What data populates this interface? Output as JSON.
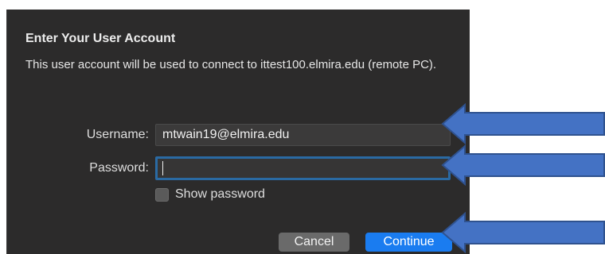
{
  "dialog": {
    "title": "Enter Your User Account",
    "description": "This user account will be used to connect to ittest100.elmira.edu (remote PC).",
    "username_label": "Username:",
    "username_value": "mtwain19@elmira.edu",
    "password_label": "Password:",
    "password_value": "",
    "show_password_label": "Show password",
    "show_password_checked": false,
    "cancel_label": "Cancel",
    "continue_label": "Continue"
  },
  "colors": {
    "dialog_bg": "#2c2b2b",
    "accent": "#1a7cf0",
    "focus_ring": "#2a6aa3",
    "annotation_arrow_fill": "#4472c4",
    "annotation_arrow_stroke": "#2f528f"
  },
  "annotations": {
    "arrows": [
      {
        "target": "username-field",
        "icon": "left-arrow-icon"
      },
      {
        "target": "password-field",
        "icon": "left-arrow-icon"
      },
      {
        "target": "continue-button",
        "icon": "left-arrow-icon"
      }
    ]
  }
}
